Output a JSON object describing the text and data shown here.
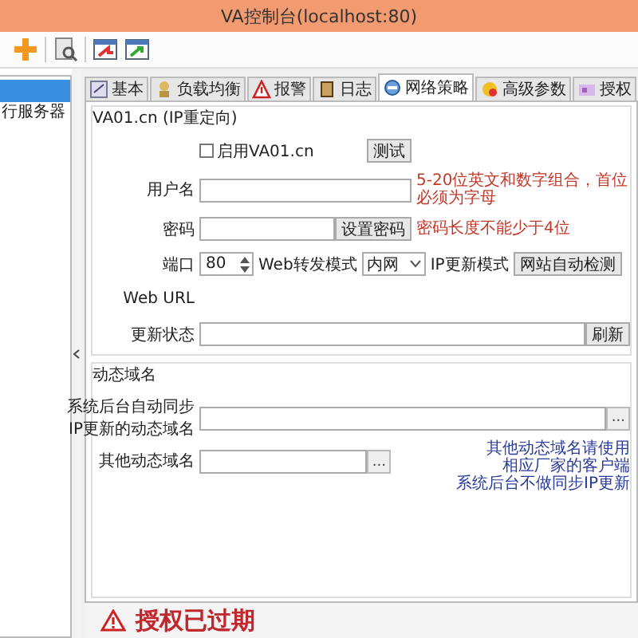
{
  "window": {
    "title": "VA控制台(localhost:80)"
  },
  "sidebar": {
    "items": [
      {
        "selected": true
      },
      {
        "label": "行服务器",
        "selected": false
      }
    ]
  },
  "tabs": [
    {
      "label": "基本",
      "selected": false
    },
    {
      "label": "负载均衡",
      "selected": false
    },
    {
      "label": "报警",
      "selected": false
    },
    {
      "label": "日志",
      "selected": false
    },
    {
      "label": "网络策略",
      "selected": true
    },
    {
      "label": "高级参数",
      "selected": false
    },
    {
      "label": "授权",
      "selected": false
    }
  ],
  "va_group": {
    "title": "VA01.cn (IP重定向)",
    "enable": {
      "label": "启用VA01.cn",
      "checked": false
    },
    "test_button": "测试",
    "username": {
      "label": "用户名",
      "hint": "5-20位英文和数字组合，首位必须为字母"
    },
    "password": {
      "label": "密码",
      "button": "设置密码",
      "hint": "密码长度不能少于4位"
    },
    "port": {
      "label": "端口",
      "value": "80"
    },
    "web_mode": {
      "label": "Web转发模式",
      "value": "内网"
    },
    "ip_mode": {
      "label": "IP更新模式",
      "value": "网站自动检测"
    },
    "web_url": {
      "label": "Web URL"
    },
    "update_status": {
      "label": "更新状态",
      "button": "刷新"
    }
  },
  "ddns_group": {
    "title": "动态域名",
    "sync_domain": {
      "label": "系统后台自动同步IP更新的动态域名",
      "button": "..."
    },
    "other_domain": {
      "label": "其他动态域名",
      "button": "..."
    },
    "note": [
      "其他动态域名请使用",
      "相应厂家的客户端",
      "系统后台不做同步IP更新"
    ]
  },
  "license_banner": {
    "text": "授权已过期"
  }
}
